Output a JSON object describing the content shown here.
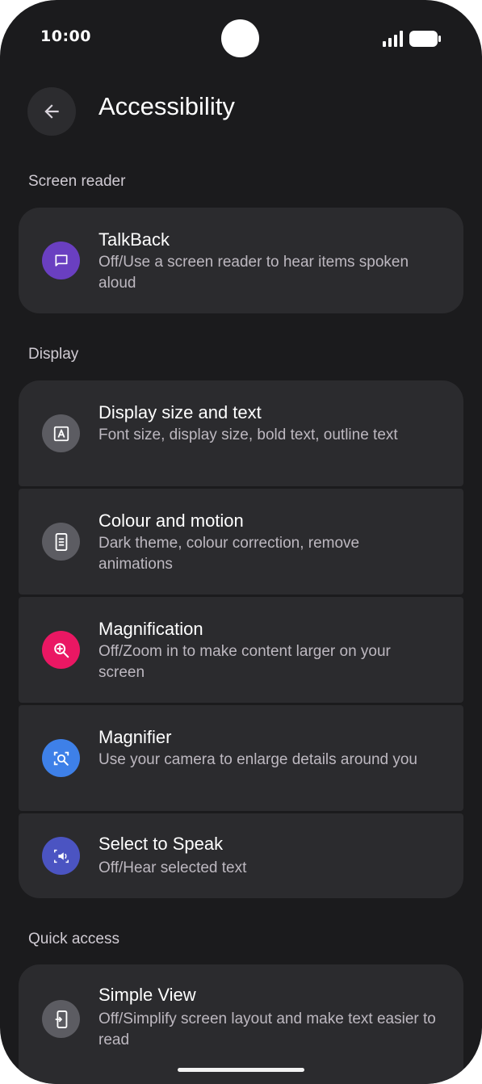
{
  "status_bar": {
    "time": "10:00"
  },
  "header": {
    "title": "Accessibility",
    "back_icon": "arrow-back-icon"
  },
  "sections": {
    "screen_reader": "Screen reader",
    "display": "Display",
    "quick_access": "Quick access"
  },
  "items": {
    "talkback": {
      "title": "TalkBack",
      "subtitle": "Off/Use a screen reader to hear items spoken aloud",
      "icon": "chat-bubble-icon",
      "color": "#6a3fc1"
    },
    "display_size": {
      "title": "Display size and text",
      "subtitle": "Font size, display size, bold text, outline text",
      "icon": "text-format-icon",
      "color": "#5c5c62"
    },
    "colour_motion": {
      "title": "Colour and motion",
      "subtitle": "Dark theme, colour correction, remove animations",
      "icon": "phone-display-icon",
      "color": "#5c5c62"
    },
    "magnification": {
      "title": "Magnification",
      "subtitle": "Off/Zoom in to make content larger on your screen",
      "icon": "zoom-in-icon",
      "color": "#ea1763"
    },
    "magnifier": {
      "title": "Magnifier",
      "subtitle": "Use your camera to enlarge details around you",
      "icon": "camera-zoom-icon",
      "color": "#3e80e8"
    },
    "select_to_speak": {
      "title": "Select to Speak",
      "subtitle": "Off/Hear selected text",
      "icon": "speaker-select-icon",
      "color": "#4b54c2"
    },
    "simple_view": {
      "title": "Simple View",
      "subtitle": "Off/Simplify screen layout and make text easier to read",
      "icon": "simple-view-icon",
      "color": "#5c5c62"
    }
  },
  "colors": {
    "background": "#1b1b1d",
    "card": "#2b2b2e",
    "title_text": "#ffffff",
    "secondary_text": "#bdb8c0"
  }
}
